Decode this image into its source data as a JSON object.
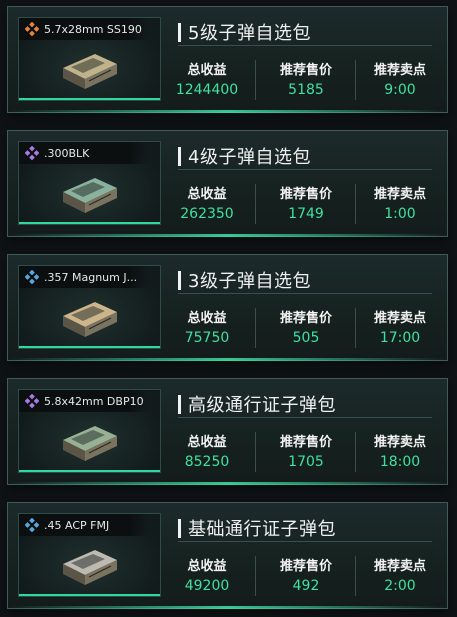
{
  "labels": {
    "revenue": "总收益",
    "price": "推荐售价",
    "time": "推荐卖点"
  },
  "packs": [
    {
      "ammo": "5.7x28mm SS190",
      "rarity_color": "#e8833a",
      "icon": "orange-diamond-icon",
      "box_color": "#c9b990",
      "title": "5级子弹自选包",
      "revenue": "1244400",
      "price": "5185",
      "time": "9:00"
    },
    {
      "ammo": ".300BLK",
      "rarity_color": "#a87be0",
      "icon": "purple-diamond-icon",
      "box_color": "#8fb8a4",
      "title": "4级子弹自选包",
      "revenue": "262350",
      "price": "1749",
      "time": "1:00"
    },
    {
      "ammo": ".357 Magnum J...",
      "rarity_color": "#5aa7e0",
      "icon": "blue-diamond-icon",
      "box_color": "#d6bd8f",
      "title": "3级子弹自选包",
      "revenue": "75750",
      "price": "505",
      "time": "17:00"
    },
    {
      "ammo": "5.8x42mm DBP10",
      "rarity_color": "#a87be0",
      "icon": "purple-diamond-icon",
      "box_color": "#9fb89a",
      "title": "高级通行证子弹包",
      "revenue": "85250",
      "price": "1705",
      "time": "18:00"
    },
    {
      "ammo": ".45 ACP FMJ",
      "rarity_color": "#5aa7e0",
      "icon": "blue-diamond-icon",
      "box_color": "#c6c3b8",
      "title": "基础通行证子弹包",
      "revenue": "49200",
      "price": "492",
      "time": "2:00"
    }
  ]
}
